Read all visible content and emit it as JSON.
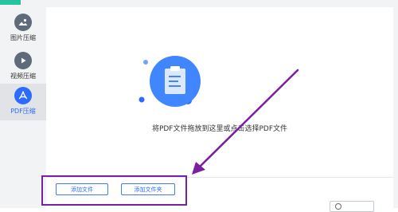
{
  "colors": {
    "accent": "#2b6cff",
    "active_icon": "#2b6cff",
    "inactive_icon": "#5f6b7a",
    "annotation": "#7b1fa2",
    "app_accent": "#27c3a0"
  },
  "sidebar": {
    "items": [
      {
        "label": "图片压缩",
        "icon": "image-icon",
        "active": false
      },
      {
        "label": "视频压缩",
        "icon": "play-icon",
        "active": false
      },
      {
        "label": "PDF压缩",
        "icon": "pdf-icon",
        "active": true
      }
    ]
  },
  "main": {
    "drop_hint": "将PDF文件拖放到这里或点击选择PDF文件",
    "illustration_icon": "clipboard-icon"
  },
  "actions": {
    "add_file_label": "添加文件",
    "add_folder_label": "添加文件夹"
  }
}
